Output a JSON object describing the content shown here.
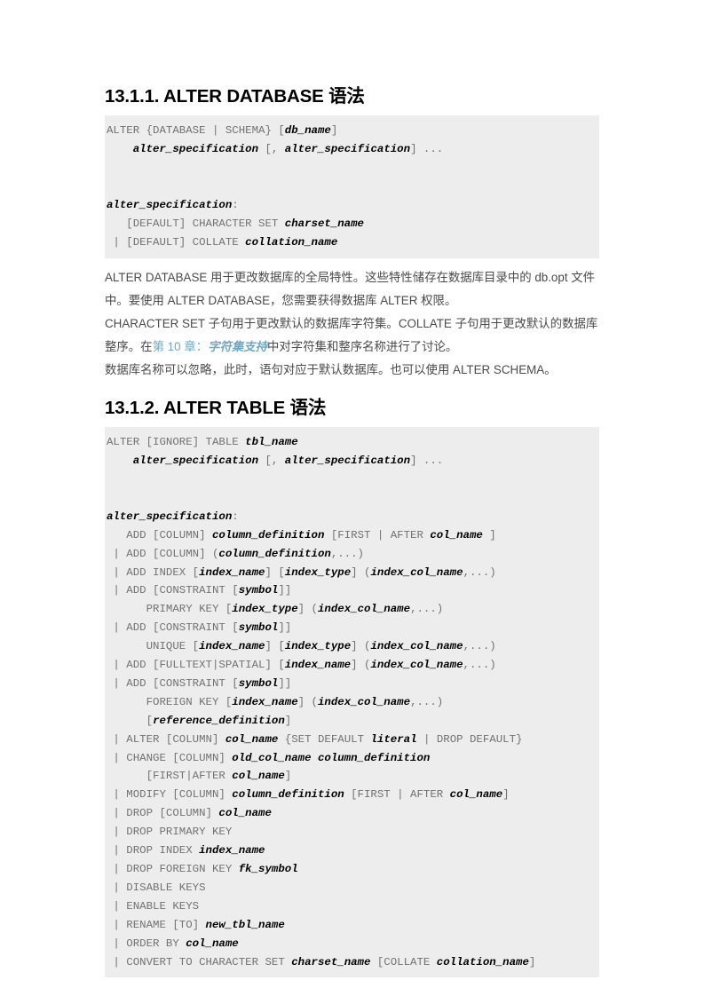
{
  "document": {
    "type": "mysql-reference-manual-page",
    "language": "zh-CN",
    "background_color": "#ffffff",
    "code_block_background": "#ededed",
    "code_text_color": "#727272",
    "code_emphasis_color": "#000000",
    "body_text_color": "#4a4a4a",
    "link_color": "#6fa8c6"
  },
  "sections": [
    {
      "id": "13.1.1",
      "heading": "13.1.1. ALTER DATABASE 语法",
      "code_lines": [
        [
          {
            "t": "ALTER {DATABASE | SCHEMA} [",
            "b": false
          },
          {
            "t": "db_name",
            "b": true
          },
          {
            "t": "]",
            "b": false
          }
        ],
        [
          {
            "t": "    ",
            "b": false
          },
          {
            "t": "alter_specification",
            "b": true
          },
          {
            "t": " [, ",
            "b": false
          },
          {
            "t": "alter_specification",
            "b": true
          },
          {
            "t": "] ...",
            "b": false
          }
        ],
        [
          {
            "t": "",
            "b": false
          }
        ],
        [
          {
            "t": "",
            "b": false
          }
        ],
        [
          {
            "t": "alter_specification",
            "b": true
          },
          {
            "t": ":",
            "b": false
          }
        ],
        [
          {
            "t": "   [DEFAULT] CHARACTER SET ",
            "b": false
          },
          {
            "t": "charset_name",
            "b": true
          }
        ],
        [
          {
            "t": " | [DEFAULT] COLLATE ",
            "b": false
          },
          {
            "t": "collation_name",
            "b": true
          }
        ]
      ],
      "paragraphs": [
        {
          "runs": [
            {
              "t": "ALTER DATABASE 用于更改数据库的全局特性。这些特性储存在数据库目录中的 db.opt 文件中。要使用 ALTER DATABASE，您需要获得数据库 ALTER 权限。",
              "link": false
            }
          ]
        },
        {
          "runs": [
            {
              "t": "CHARACTER SET 子句用于更改默认的数据库字符集。COLLATE 子句用于更改默认的数据库整序。在",
              "link": false
            },
            {
              "t": "第 10 章：",
              "link": true,
              "italic": false
            },
            {
              "t": "字符集支持",
              "link": true,
              "italic": true
            },
            {
              "t": "中对字符集和整序名称进行了讨论。",
              "link": false
            }
          ]
        },
        {
          "runs": [
            {
              "t": "数据库名称可以忽略，此时，语句对应于默认数据库。也可以使用 ALTER SCHEMA。",
              "link": false
            }
          ]
        }
      ]
    },
    {
      "id": "13.1.2",
      "heading": "13.1.2. ALTER TABLE 语法",
      "code_lines": [
        [
          {
            "t": "ALTER [IGNORE] TABLE ",
            "b": false
          },
          {
            "t": "tbl_name",
            "b": true
          }
        ],
        [
          {
            "t": "    ",
            "b": false
          },
          {
            "t": "alter_specification",
            "b": true
          },
          {
            "t": " [, ",
            "b": false
          },
          {
            "t": "alter_specification",
            "b": true
          },
          {
            "t": "] ...",
            "b": false
          }
        ],
        [
          {
            "t": "",
            "b": false
          }
        ],
        [
          {
            "t": "",
            "b": false
          }
        ],
        [
          {
            "t": "alter_specification",
            "b": true
          },
          {
            "t": ":",
            "b": false
          }
        ],
        [
          {
            "t": "   ADD [COLUMN] ",
            "b": false
          },
          {
            "t": "column_definition",
            "b": true
          },
          {
            "t": " [FIRST | AFTER ",
            "b": false
          },
          {
            "t": "col_name",
            "b": true
          },
          {
            "t": " ]",
            "b": false
          }
        ],
        [
          {
            "t": " | ADD [COLUMN] (",
            "b": false
          },
          {
            "t": "column_definition",
            "b": true
          },
          {
            "t": ",...)",
            "b": false
          }
        ],
        [
          {
            "t": " | ADD INDEX [",
            "b": false
          },
          {
            "t": "index_name",
            "b": true
          },
          {
            "t": "] [",
            "b": false
          },
          {
            "t": "index_type",
            "b": true
          },
          {
            "t": "] (",
            "b": false
          },
          {
            "t": "index_col_name",
            "b": true
          },
          {
            "t": ",...)",
            "b": false
          }
        ],
        [
          {
            "t": " | ADD [CONSTRAINT [",
            "b": false
          },
          {
            "t": "symbol",
            "b": true
          },
          {
            "t": "]]",
            "b": false
          }
        ],
        [
          {
            "t": "      PRIMARY KEY [",
            "b": false
          },
          {
            "t": "index_type",
            "b": true
          },
          {
            "t": "] (",
            "b": false
          },
          {
            "t": "index_col_name",
            "b": true
          },
          {
            "t": ",...)",
            "b": false
          }
        ],
        [
          {
            "t": " | ADD [CONSTRAINT [",
            "b": false
          },
          {
            "t": "symbol",
            "b": true
          },
          {
            "t": "]]",
            "b": false
          }
        ],
        [
          {
            "t": "      UNIQUE [",
            "b": false
          },
          {
            "t": "index_name",
            "b": true
          },
          {
            "t": "] [",
            "b": false
          },
          {
            "t": "index_type",
            "b": true
          },
          {
            "t": "] (",
            "b": false
          },
          {
            "t": "index_col_name",
            "b": true
          },
          {
            "t": ",...)",
            "b": false
          }
        ],
        [
          {
            "t": " | ADD [FULLTEXT|SPATIAL] [",
            "b": false
          },
          {
            "t": "index_name",
            "b": true
          },
          {
            "t": "] (",
            "b": false
          },
          {
            "t": "index_col_name",
            "b": true
          },
          {
            "t": ",...)",
            "b": false
          }
        ],
        [
          {
            "t": " | ADD [CONSTRAINT [",
            "b": false
          },
          {
            "t": "symbol",
            "b": true
          },
          {
            "t": "]]",
            "b": false
          }
        ],
        [
          {
            "t": "      FOREIGN KEY [",
            "b": false
          },
          {
            "t": "index_name",
            "b": true
          },
          {
            "t": "] (",
            "b": false
          },
          {
            "t": "index_col_name",
            "b": true
          },
          {
            "t": ",...)",
            "b": false
          }
        ],
        [
          {
            "t": "      [",
            "b": false
          },
          {
            "t": "reference_definition",
            "b": true
          },
          {
            "t": "]",
            "b": false
          }
        ],
        [
          {
            "t": " | ALTER [COLUMN] ",
            "b": false
          },
          {
            "t": "col_name",
            "b": true
          },
          {
            "t": " {SET DEFAULT ",
            "b": false
          },
          {
            "t": "literal",
            "b": true
          },
          {
            "t": " | DROP DEFAULT}",
            "b": false
          }
        ],
        [
          {
            "t": " | CHANGE [COLUMN] ",
            "b": false
          },
          {
            "t": "old_col_name column_definition",
            "b": true
          }
        ],
        [
          {
            "t": "      [FIRST|AFTER ",
            "b": false
          },
          {
            "t": "col_name",
            "b": true
          },
          {
            "t": "]",
            "b": false
          }
        ],
        [
          {
            "t": " | MODIFY [COLUMN] ",
            "b": false
          },
          {
            "t": "column_definition",
            "b": true
          },
          {
            "t": " [FIRST | AFTER ",
            "b": false
          },
          {
            "t": "col_name",
            "b": true
          },
          {
            "t": "]",
            "b": false
          }
        ],
        [
          {
            "t": " | DROP [COLUMN] ",
            "b": false
          },
          {
            "t": "col_name",
            "b": true
          }
        ],
        [
          {
            "t": " | DROP PRIMARY KEY",
            "b": false
          }
        ],
        [
          {
            "t": " | DROP INDEX ",
            "b": false
          },
          {
            "t": "index_name",
            "b": true
          }
        ],
        [
          {
            "t": " | DROP FOREIGN KEY ",
            "b": false
          },
          {
            "t": "fk_symbol",
            "b": true
          }
        ],
        [
          {
            "t": " | DISABLE KEYS",
            "b": false
          }
        ],
        [
          {
            "t": " | ENABLE KEYS",
            "b": false
          }
        ],
        [
          {
            "t": " | RENAME [TO] ",
            "b": false
          },
          {
            "t": "new_tbl_name",
            "b": true
          }
        ],
        [
          {
            "t": " | ORDER BY ",
            "b": false
          },
          {
            "t": "col_name",
            "b": true
          }
        ],
        [
          {
            "t": " | CONVERT TO CHARACTER SET ",
            "b": false
          },
          {
            "t": "charset_name",
            "b": true
          },
          {
            "t": " [COLLATE ",
            "b": false
          },
          {
            "t": "collation_name",
            "b": true
          },
          {
            "t": "]",
            "b": false
          }
        ]
      ],
      "paragraphs": []
    }
  ]
}
